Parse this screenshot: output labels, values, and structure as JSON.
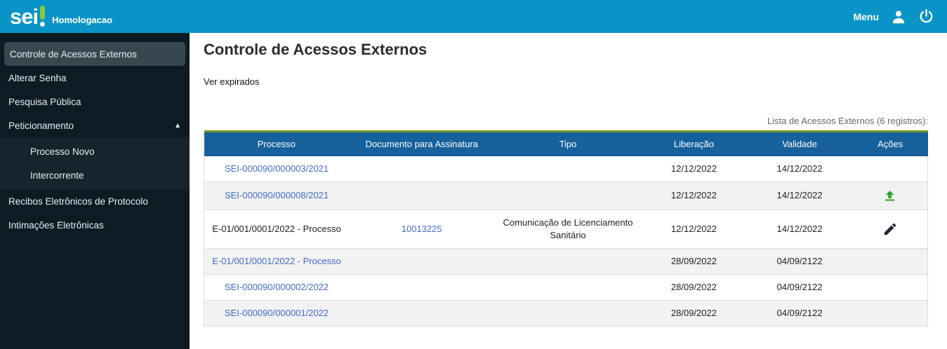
{
  "topbar": {
    "logo_text": "sei",
    "environment": "Homologacao",
    "menu_label": "Menu"
  },
  "colors": {
    "topbar_blue": "#0894c6",
    "logo_green": "#8dc63f",
    "table_header_blue": "#16619c",
    "table_top_border_olive": "#72941f",
    "link_blue": "#4169cd",
    "upload_icon_green": "#2fa12f",
    "sidebar_dark": "#0c1b24",
    "sidebar_selected": "#37474f",
    "row_stripe": "#f2f2f2"
  },
  "sidebar": {
    "items": [
      {
        "label": "Controle de Acessos Externos",
        "selected": true
      },
      {
        "label": "Alterar Senha"
      },
      {
        "label": "Pesquisa Pública"
      },
      {
        "label": "Peticionamento",
        "expanded": true
      },
      {
        "label": "Processo Novo",
        "submenu": true
      },
      {
        "label": "Intercorrente",
        "submenu": true
      },
      {
        "label": "Recibos Eletrônicos de Protocolo"
      },
      {
        "label": "Intimações Eletrônicas"
      }
    ]
  },
  "main": {
    "title": "Controle de Acessos Externos",
    "ver_expirados": "Ver expirados",
    "list_caption": "Lista de Acessos Externos (6 registros):"
  },
  "table": {
    "headers": [
      "Processo",
      "Documento para Assinatura",
      "Tipo",
      "Liberação",
      "Validade",
      "Ações"
    ],
    "rows": [
      {
        "processo": "SEI-000090/000003/2021",
        "documento": "",
        "tipo": "",
        "liberacao": "12/12/2022",
        "validade": "14/12/2022",
        "acao": ""
      },
      {
        "processo": "SEI-000090/000008/2021",
        "documento": "",
        "tipo": "",
        "liberacao": "12/12/2022",
        "validade": "14/12/2022",
        "acao": "upload-icon"
      },
      {
        "processo": "E-01/001/0001/2022 - Processo",
        "documento": "10013225",
        "tipo": "Comunicação de Licenciamento Sanitário",
        "liberacao": "12/12/2022",
        "validade": "14/12/2022",
        "acao": "sign-pen-icon"
      },
      {
        "processo": "E-01/001/0001/2022 - Processo",
        "documento": "",
        "tipo": "",
        "liberacao": "28/09/2022",
        "validade": "04/09/2122",
        "acao": ""
      },
      {
        "processo": "SEI-000090/000002/2022",
        "documento": "",
        "tipo": "",
        "liberacao": "28/09/2022",
        "validade": "04/09/2122",
        "acao": ""
      },
      {
        "processo": "SEI-000090/000001/2022",
        "documento": "",
        "tipo": "",
        "liberacao": "28/09/2022",
        "validade": "04/09/2122",
        "acao": ""
      }
    ]
  }
}
